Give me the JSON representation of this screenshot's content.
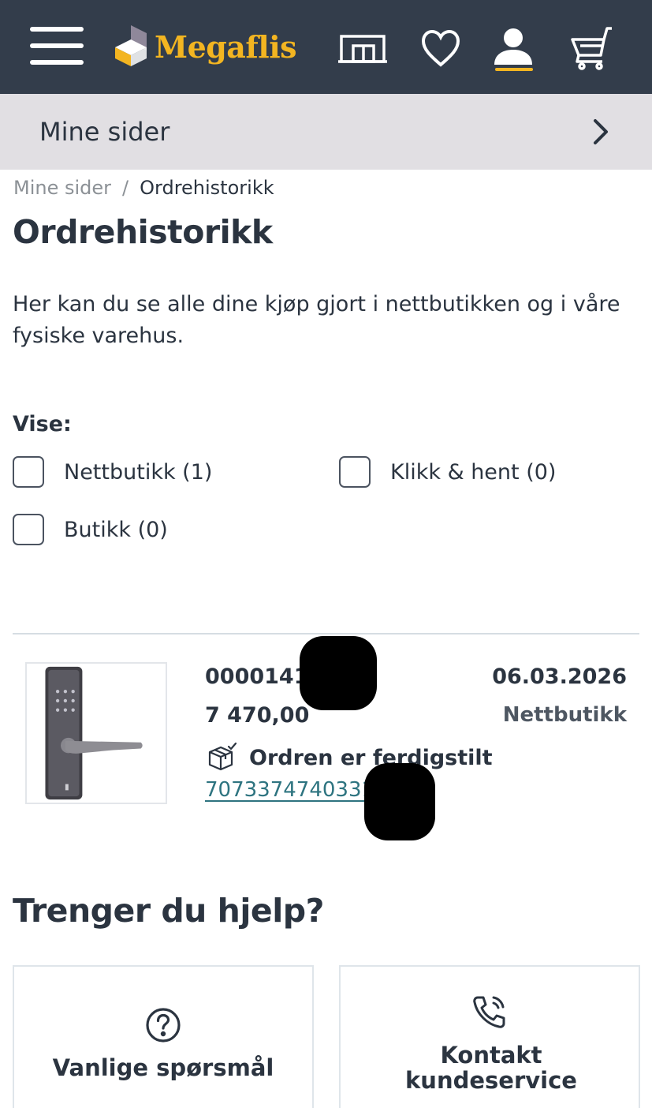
{
  "header": {
    "brand": "Megaflis",
    "icons": [
      "menu-icon",
      "store-icon",
      "heart-icon",
      "account-icon",
      "cart-icon"
    ],
    "colors": {
      "bg": "#333d4b",
      "accent": "#f3b521"
    }
  },
  "subnav": {
    "label": "Mine sider"
  },
  "breadcrumb": {
    "parent": "Mine sider",
    "separator": "/",
    "current": "Ordrehistorikk"
  },
  "page": {
    "title": "Ordrehistorikk",
    "intro": "Her kan du se alle dine kjøp gjort i nettbutikken og i våre fysiske varehus."
  },
  "filters": {
    "label": "Vise:",
    "options": [
      {
        "label": "Nettbutikk (1)",
        "checked": false
      },
      {
        "label": "Klikk & hent (0)",
        "checked": false
      },
      {
        "label": "Butikk (0)",
        "checked": false
      }
    ]
  },
  "order": {
    "number": "00001414",
    "price": "7 470,00",
    "date": "06.03.2026",
    "channel": "Nettbutikk",
    "status": "Ordren er ferdigstilt",
    "tracking": "7073374740331"
  },
  "help": {
    "title": "Trenger du hjelp?",
    "faq_label": "Vanlige spørsmål",
    "contact_label": "Kontakt kundeservice"
  }
}
